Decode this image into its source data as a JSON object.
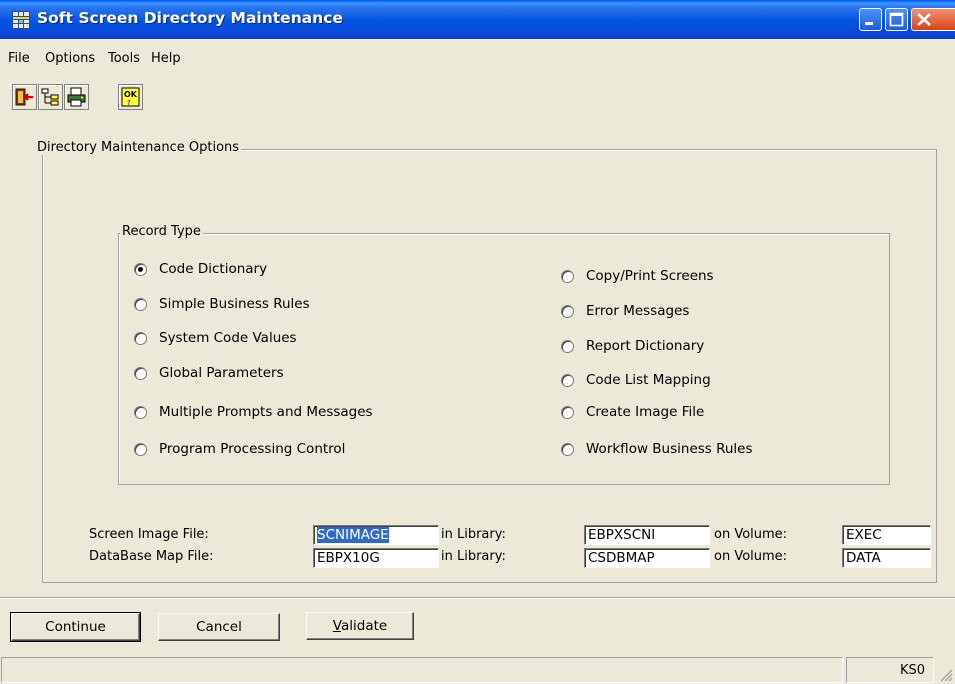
{
  "window": {
    "title": "Soft Screen Directory Maintenance"
  },
  "menu": [
    "File",
    "Options",
    "Tools",
    "Help"
  ],
  "toolbar": [
    {
      "icon": "exit-door-icon"
    },
    {
      "icon": "tree-structure-icon"
    },
    {
      "icon": "printer-icon"
    },
    {
      "icon": "ok-validate-icon",
      "text": "OK"
    }
  ],
  "options_group": {
    "label": "Directory Maintenance Options"
  },
  "record_type": {
    "label": "Record Type",
    "selected": "Code Dictionary",
    "left": [
      "Code Dictionary",
      "Simple Business Rules",
      "System Code Values",
      "Global Parameters",
      "Multiple Prompts and Messages",
      "Program Processing Control"
    ],
    "right": [
      "Copy/Print Screens",
      "Error Messages",
      "Report Dictionary",
      "Code List Mapping",
      "Create Image File",
      "Workflow Business Rules"
    ]
  },
  "files": {
    "screen_image": {
      "label": "Screen Image File:",
      "value": "SCNIMAGE",
      "library_label": "in Library:",
      "library": "EBPXSCNI",
      "volume_label": "on Volume:",
      "volume": "EXEC"
    },
    "database_map": {
      "label": "DataBase Map File:",
      "value": "EBPX10G",
      "library_label": "in Library:",
      "library": "CSDBMAP",
      "volume_label": "on Volume:",
      "volume": "DATA"
    }
  },
  "buttons": {
    "continue": "Continue",
    "cancel": "Cancel",
    "validate_mnemonic": "V",
    "validate_rest": "alidate"
  },
  "status": {
    "left": "",
    "right": "KS0"
  }
}
